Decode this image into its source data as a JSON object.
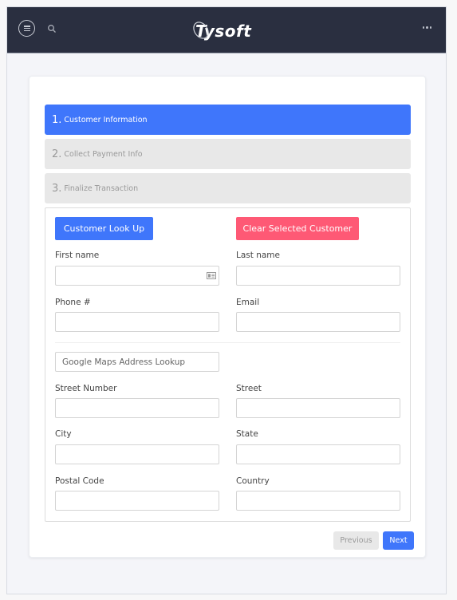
{
  "header": {
    "logo_text": "Tysoft",
    "menu_icon": "hamburger-menu-icon",
    "search_icon": "search-icon",
    "more_icon": "more-horizontal-icon"
  },
  "wizard": {
    "steps": [
      {
        "number": "1.",
        "label": "Customer Information",
        "state": "active"
      },
      {
        "number": "2.",
        "label": "Collect Payment Info",
        "state": "inactive"
      },
      {
        "number": "3.",
        "label": "Finalize Transaction",
        "state": "inactive"
      }
    ]
  },
  "customer": {
    "lookup_button": "Customer Look Up",
    "clear_button": "Clear Selected Customer",
    "fields": {
      "first_name": {
        "label": "First name",
        "value": ""
      },
      "last_name": {
        "label": "Last name",
        "value": ""
      },
      "phone": {
        "label": "Phone #",
        "value": ""
      },
      "email": {
        "label": "Email",
        "value": ""
      }
    }
  },
  "address": {
    "lookup_placeholder": "Google Maps Address Lookup",
    "fields": {
      "street_number": {
        "label": "Street Number",
        "value": ""
      },
      "street": {
        "label": "Street",
        "value": ""
      },
      "city": {
        "label": "City",
        "value": ""
      },
      "state": {
        "label": "State",
        "value": ""
      },
      "postal_code": {
        "label": "Postal Code",
        "value": ""
      },
      "country": {
        "label": "Country",
        "value": ""
      }
    }
  },
  "navigation": {
    "previous_label": "Previous",
    "next_label": "Next"
  },
  "colors": {
    "header_bg": "#2a2f40",
    "primary": "#3f76fb",
    "danger": "#fe5975",
    "inactive_step": "#e8e8e8"
  }
}
